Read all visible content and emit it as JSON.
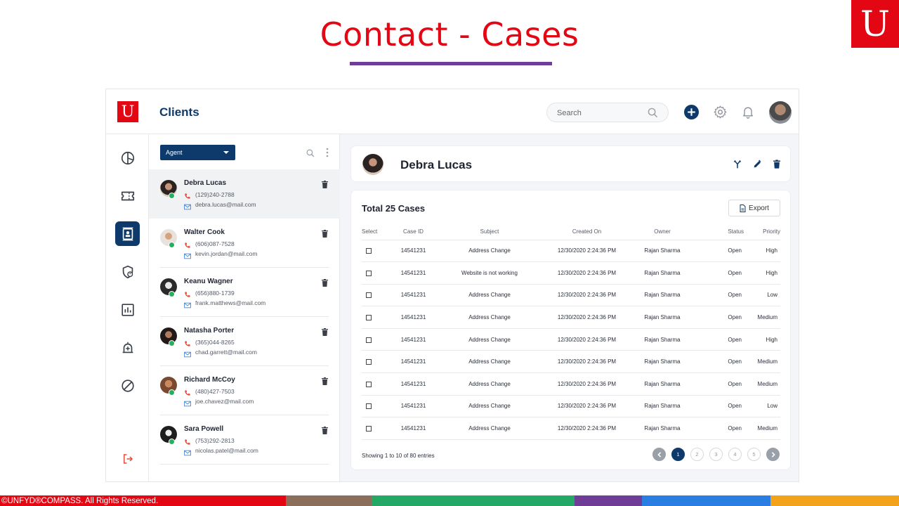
{
  "slide": {
    "title": "Contact - Cases",
    "logo_letter": "U",
    "footer_text": "©UNFYD®COMPASS. All Rights Reserved.",
    "colors": {
      "title": "#e30613",
      "underline": "#6f3c97",
      "brand_red": "#e30613"
    },
    "footer_colors": [
      "#e30613",
      "#8b6f5a",
      "#23a866",
      "#6f3c97",
      "#2a7de1",
      "#f2a21b"
    ]
  },
  "app": {
    "logo_letter": "U",
    "title": "Clients",
    "search": {
      "placeholder": "Search"
    },
    "header_icons": [
      "add-circle-icon",
      "gear-icon",
      "bell-icon"
    ],
    "colors": {
      "primary": "#0e3a6b",
      "accent_red": "#e74c3c"
    }
  },
  "sidebar": {
    "items": [
      {
        "icon": "dashboard-pie-icon",
        "active": false
      },
      {
        "icon": "ticket-icon",
        "active": false
      },
      {
        "icon": "contact-card-icon",
        "active": true
      },
      {
        "icon": "shield-user-icon",
        "active": false
      },
      {
        "icon": "bar-chart-icon",
        "active": false
      },
      {
        "icon": "alarm-add-icon",
        "active": false
      },
      {
        "icon": "block-icon",
        "active": false
      }
    ],
    "logout_icon": "logout-icon"
  },
  "contact_list": {
    "filter_label": "Agent",
    "contacts": [
      {
        "name": "Debra Lucas",
        "phone": "(129)240-2788",
        "email": "debra.lucas@mail.com"
      },
      {
        "name": "Walter Cook",
        "phone": "(606)087-7528",
        "email": "kevin.jordan@mail.com"
      },
      {
        "name": "Keanu Wagner",
        "phone": "(656)880-1739",
        "email": "frank.matthews@mail.com"
      },
      {
        "name": "Natasha Porter",
        "phone": "(365)044-8265",
        "email": "chad.garrett@mail.com"
      },
      {
        "name": "Richard McCoy",
        "phone": "(480)427-7503",
        "email": "joe.chavez@mail.com"
      },
      {
        "name": "Sara Powell",
        "phone": "(753)292-2813",
        "email": "nicolas.patel@mail.com"
      }
    ]
  },
  "profile": {
    "name": "Debra Lucas"
  },
  "cases": {
    "title": "Total 25 Cases",
    "export_label": "Export",
    "columns": [
      "Select",
      "Case ID",
      "Subject",
      "Created On",
      "Owner",
      "Status",
      "Priority"
    ],
    "rows": [
      {
        "case_id": "14541231",
        "subject": "Address Change",
        "created_on": "12/30/2020 2:24:36 PM",
        "owner": "Rajan Sharma",
        "status": "Open",
        "priority": "High"
      },
      {
        "case_id": "14541231",
        "subject": "Website is not working",
        "created_on": "12/30/2020 2:24:36 PM",
        "owner": "Rajan Sharma",
        "status": "Open",
        "priority": "High"
      },
      {
        "case_id": "14541231",
        "subject": "Address Change",
        "created_on": "12/30/2020 2:24:36 PM",
        "owner": "Rajan Sharma",
        "status": "Open",
        "priority": "Low"
      },
      {
        "case_id": "14541231",
        "subject": "Address Change",
        "created_on": "12/30/2020 2:24:36 PM",
        "owner": "Rajan Sharma",
        "status": "Open",
        "priority": "Medium"
      },
      {
        "case_id": "14541231",
        "subject": "Address Change",
        "created_on": "12/30/2020 2:24:36 PM",
        "owner": "Rajan Sharma",
        "status": "Open",
        "priority": "High"
      },
      {
        "case_id": "14541231",
        "subject": "Address Change",
        "created_on": "12/30/2020 2:24:36 PM",
        "owner": "Rajan Sharma",
        "status": "Open",
        "priority": "Medium"
      },
      {
        "case_id": "14541231",
        "subject": "Address Change",
        "created_on": "12/30/2020 2:24:36 PM",
        "owner": "Rajan Sharma",
        "status": "Open",
        "priority": "Medium"
      },
      {
        "case_id": "14541231",
        "subject": "Address Change",
        "created_on": "12/30/2020 2:24:36 PM",
        "owner": "Rajan Sharma",
        "status": "Open",
        "priority": "Low"
      },
      {
        "case_id": "14541231",
        "subject": "Address Change",
        "created_on": "12/30/2020 2:24:36 PM",
        "owner": "Rajan Sharma",
        "status": "Open",
        "priority": "Medium"
      }
    ],
    "showing_text": "Showing 1 to 10 of 80 entries",
    "pages": [
      "1",
      "2",
      "3",
      "4",
      "5"
    ],
    "current_page": "1"
  }
}
